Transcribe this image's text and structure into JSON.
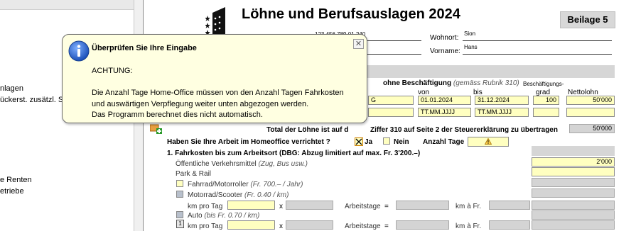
{
  "nav": {
    "items": [
      {
        "label": "nlagen"
      },
      {
        "label": "ückerst. zusätzl. St"
      },
      {
        "label": "e Renten"
      },
      {
        "label": "etriebe"
      }
    ]
  },
  "form": {
    "title": "Löhne und Berufsauslagen 2024",
    "beilage": "Beilage 5",
    "ahv_number": "123.456.789.01.240",
    "wohnort_label": "Wohnort:",
    "wohnort_value": "Sion",
    "vorname_label": "Vorname:",
    "vorname_value": "Hans",
    "section1": {
      "title_bold": "ohne Beschäftigung",
      "title_italic": "(gemäss Rubrik 310)",
      "col_von": "von",
      "col_bis": "bis",
      "col_grad": "Beschäftigungs-grad",
      "col_grad_line1": "Beschäftigungs-",
      "col_grad_line2": "grad",
      "col_nettolohn": "Nettolohn",
      "row1": {
        "name_partial": "G",
        "von": "01.01.2024",
        "bis": "31.12.2024",
        "grad": "100",
        "nettolohn": "50'000"
      },
      "row2": {
        "von": "TT.MM.JJJJ",
        "bis": "TT.MM.JJJJ",
        "grad": "",
        "nettolohn": ""
      }
    },
    "total_label_prefix": "Total der Löhne ist auf d",
    "total_label_suffix": "Ziffer 310 auf Seite 2 der Steuererklärung zu übertragen",
    "total_value": "50'000",
    "homeoffice_question": "Haben Sie Ihre Arbeit im Homeoffice verrichtet ?",
    "ja_label": "Ja",
    "nein_label": "Nein",
    "anzahl_tage_label": "Anzahl Tage",
    "fahrkosten_title": "1.  Fahrkosten bis zum Arbeitsort (DBG: Abzug limitiert auf max. Fr. 3'200.–)",
    "oev_label": "Öffentliche Verkehrsmittel",
    "oev_note": "(Zug, Bus usw.)",
    "oev_value": "2'000",
    "park_rail_label": "Park & Rail",
    "fahrrad_label": "Fahrrad/Motorroller",
    "fahrrad_note": "(Fr. 700.– / Jahr)",
    "motorrad_label": "Motorrad/Scooter",
    "motorrad_note": "(Fr. 0.40 / km)",
    "km_pro_tag": "km pro Tag",
    "x_sign": "x",
    "arbeitstage": "Arbeitstage",
    "equals": "=",
    "km_a_fr": "km à Fr.",
    "auto_label": "Auto",
    "auto_note": "(bis Fr. 0.70 / km)",
    "auto_count": "1"
  },
  "tooltip": {
    "title": "Überprüfen Sie Ihre Eingabe",
    "heading": "ACHTUNG:",
    "lines": [
      "Die Anzahl Tage Home-Office müssen von den Anzahl Tagen Fahrkosten",
      "und auswärtigen Verpflegung weiter unten abgezogen werden.",
      "Das Programm berechnet dies nicht automatisch."
    ],
    "close_symbol": "✕"
  },
  "colors": {
    "field_yellow": "#ffffc0",
    "tooltip_bg": "#ffffe1",
    "gray_field": "#d4d4d4",
    "info_blue": "#2a62c9",
    "warning_orange": "#e0a000"
  }
}
